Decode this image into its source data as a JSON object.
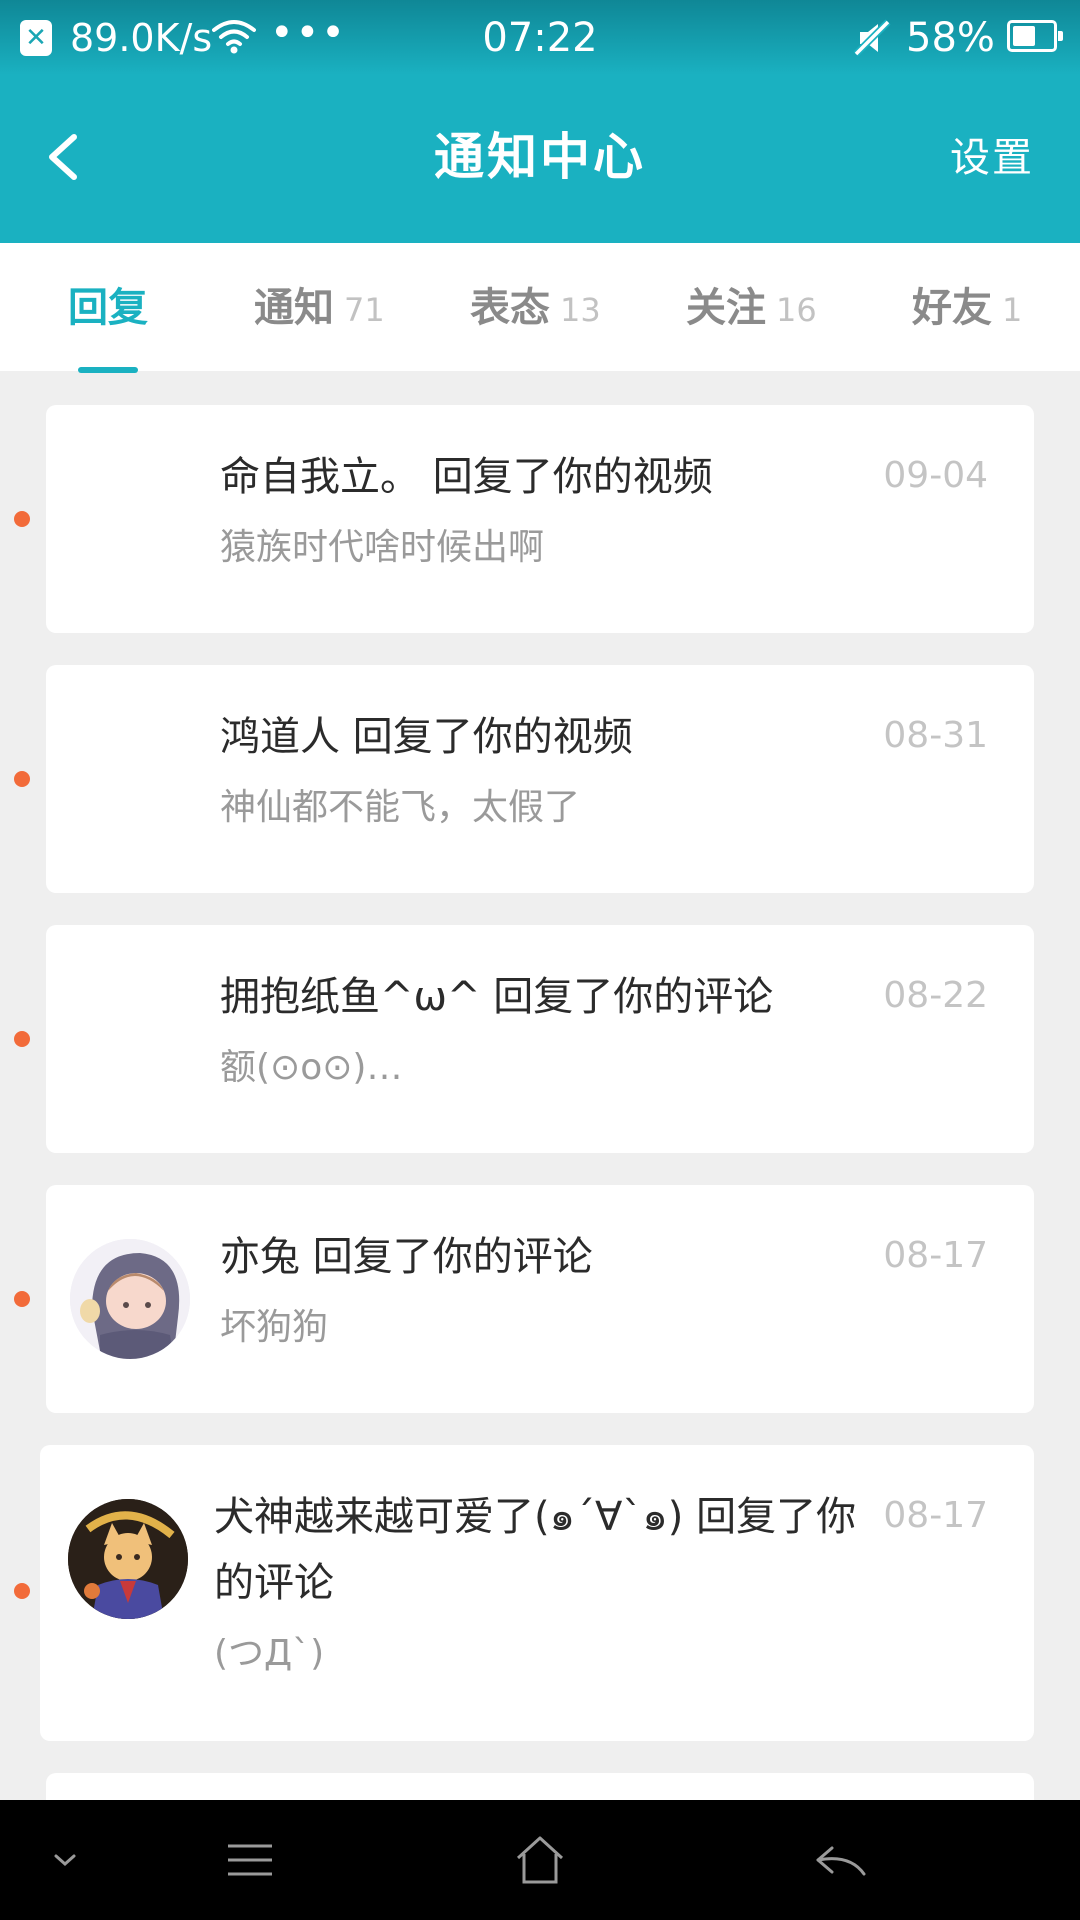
{
  "status_bar": {
    "app_icon": "x-close-icon",
    "net_speed": "89.0K/s",
    "wifi_icon": "wifi-icon",
    "overflow_icon": "more-dots-icon",
    "overflow_text": "•••",
    "time": "07:22",
    "mute_icon": "mute-icon",
    "battery_percent_text": "58%",
    "battery_level": 0.58,
    "x_glyph": "✕"
  },
  "header": {
    "back_icon": "chevron-left-icon",
    "title": "通知中心",
    "settings_label": "设置"
  },
  "tabs": [
    {
      "label": "回复",
      "count": "",
      "active": true
    },
    {
      "label": "通知",
      "count": "71",
      "active": false
    },
    {
      "label": "表态",
      "count": "13",
      "active": false
    },
    {
      "label": "关注",
      "count": "16",
      "active": false
    },
    {
      "label": "好友",
      "count": "1",
      "active": false
    }
  ],
  "notifications": [
    {
      "title": "命自我立。 回复了你的视频",
      "body": "猿族时代啥时候出啊",
      "date": "09-04",
      "unread": true,
      "avatar": "none"
    },
    {
      "title": "鸿道人 回复了你的视频",
      "body": "神仙都不能飞，太假了",
      "date": "08-31",
      "unread": true,
      "avatar": "none"
    },
    {
      "title": "拥抱纸鱼^ω^ 回复了你的评论",
      "body": "额(⊙o⊙)…",
      "date": "08-22",
      "unread": true,
      "avatar": "none"
    },
    {
      "title": "亦兔 回复了你的评论",
      "body": "坏狗狗",
      "date": "08-17",
      "unread": true,
      "avatar": "anime-hooded-character-avatar"
    },
    {
      "title": "犬神越来越可爱了(๑´∀`๑) 回复了你的评论",
      "body": "(つД`)",
      "date": "08-17",
      "unread": true,
      "avatar": "anime-dog-character-avatar"
    }
  ],
  "nav_bar": {
    "collapse_icon": "chevron-down-icon",
    "menu_icon": "menu-icon",
    "home_icon": "home-icon",
    "back_icon": "back-arrow-icon"
  },
  "colors": {
    "accent": "#1ab1c1",
    "unread_dot": "#f26b3a",
    "background": "#efefef",
    "nav_bar": "#000000"
  }
}
